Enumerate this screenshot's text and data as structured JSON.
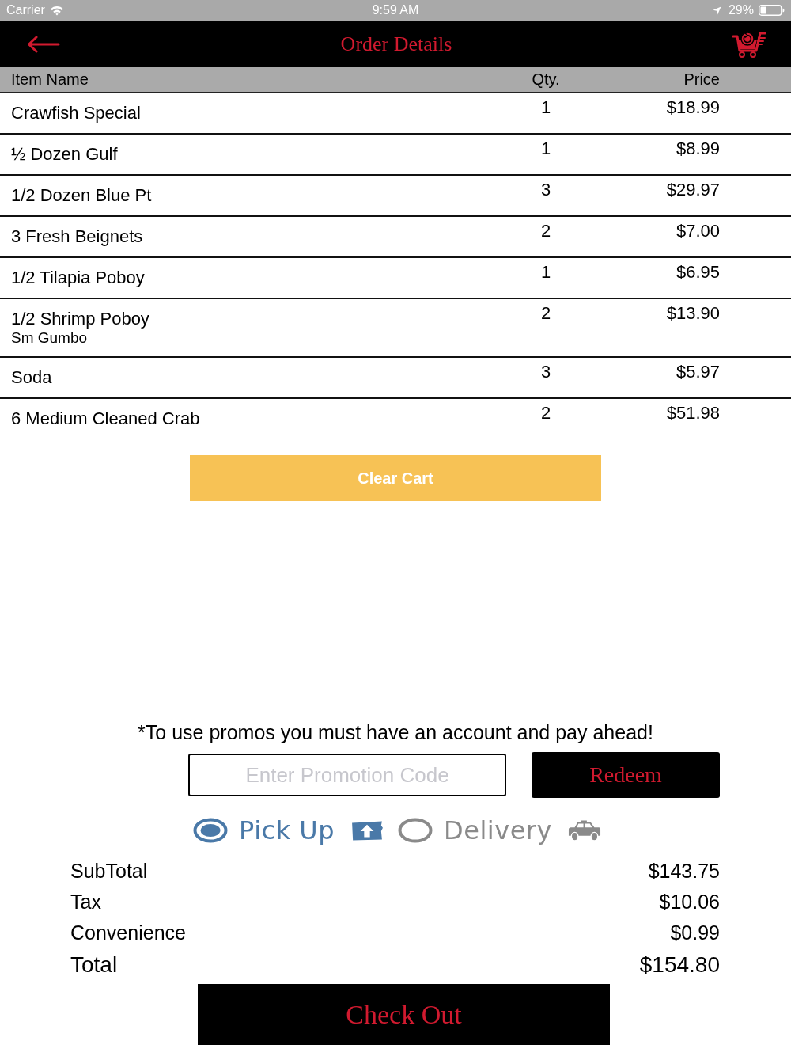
{
  "status_bar": {
    "carrier": "Carrier",
    "time": "9:59 AM",
    "battery": "29%"
  },
  "nav_bar": {
    "title": "Order Details"
  },
  "table": {
    "columns": [
      "Item Name",
      "Qty.",
      "Price"
    ],
    "rows": [
      {
        "item": "Crawfish Special",
        "qty": "1",
        "price": "$18.99"
      },
      {
        "item": "½ Dozen Gulf",
        "qty": "1",
        "price": "$8.99"
      },
      {
        "item": "1/2 Dozen Blue Pt",
        "qty": "3",
        "price": "$29.97"
      },
      {
        "item": "3 Fresh Beignets",
        "qty": "2",
        "price": "$7.00"
      },
      {
        "item": "1/2 Tilapia Poboy",
        "qty": "1",
        "price": "$6.95"
      },
      {
        "item": "1/2 Shrimp Poboy",
        "note": "Sm Gumbo",
        "qty": "2",
        "price": "$13.90"
      },
      {
        "item": "Soda",
        "qty": "3",
        "price": "$5.97"
      },
      {
        "item": "6 Medium Cleaned Crab",
        "qty": "2",
        "price": "$51.98"
      }
    ]
  },
  "clear_cart_button": "Clear Cart",
  "promo": {
    "notice": "*To use promos you must have an account and pay ahead!",
    "placeholder": "Enter Promotion Code",
    "button": "Redeem"
  },
  "order_types": [
    {
      "kind": "pickup",
      "label": "Pick Up",
      "selected": true
    },
    {
      "kind": "delivery",
      "label": "Delivery",
      "selected": false
    }
  ],
  "totals": [
    {
      "kind": "line",
      "label": "SubTotal",
      "value": "$143.75"
    },
    {
      "kind": "line",
      "label": "Tax",
      "value": "$10.06"
    },
    {
      "kind": "line",
      "label": "Convenience",
      "value": "$0.99"
    },
    {
      "kind": "total",
      "label": "Total",
      "value": "$154.80"
    }
  ],
  "checkout_button": "Check Out"
}
